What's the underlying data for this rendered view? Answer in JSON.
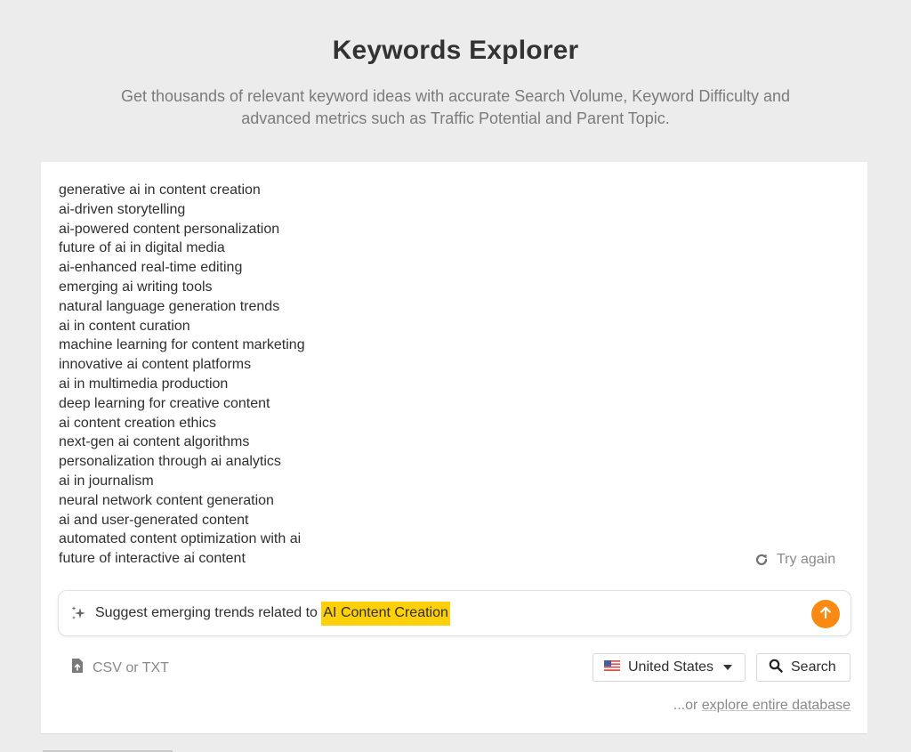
{
  "header": {
    "title": "Keywords Explorer",
    "subtitle_line1": "Get thousands of relevant keyword ideas with accurate Search Volume, Keyword Difficulty and",
    "subtitle_line2": "advanced metrics such as Traffic Potential and Parent Topic."
  },
  "results": [
    "generative ai in content creation",
    "ai-driven storytelling",
    "ai-powered content personalization",
    "future of ai in digital media",
    "ai-enhanced real-time editing",
    "emerging ai writing tools",
    "natural language generation trends",
    "ai in content curation",
    "machine learning for content marketing",
    "innovative ai content platforms",
    "ai in multimedia production",
    "deep learning for creative content",
    "ai content creation ethics",
    "next-gen ai content algorithms",
    "personalization through ai analytics",
    "ai in journalism",
    "neural network content generation",
    "ai and user-generated content",
    "automated content optimization with ai",
    "future of interactive ai content"
  ],
  "try_again": {
    "label": "Try again",
    "icon": "refresh-icon"
  },
  "prompt": {
    "icon": "sparkle-icon",
    "text": "Suggest emerging trends related to ",
    "highlight": "AI Content Creation",
    "highlight_color": "#fed00a",
    "send_icon": "arrow-up-icon",
    "send_color": "#fb8a14"
  },
  "upload": {
    "label": "CSV or TXT",
    "icon": "file-upload-icon"
  },
  "country": {
    "selected": "United States",
    "icon": "us-flag-icon"
  },
  "search": {
    "label": "Search",
    "icon": "search-icon"
  },
  "explore": {
    "prefix": "...or ",
    "link": "explore entire database"
  }
}
